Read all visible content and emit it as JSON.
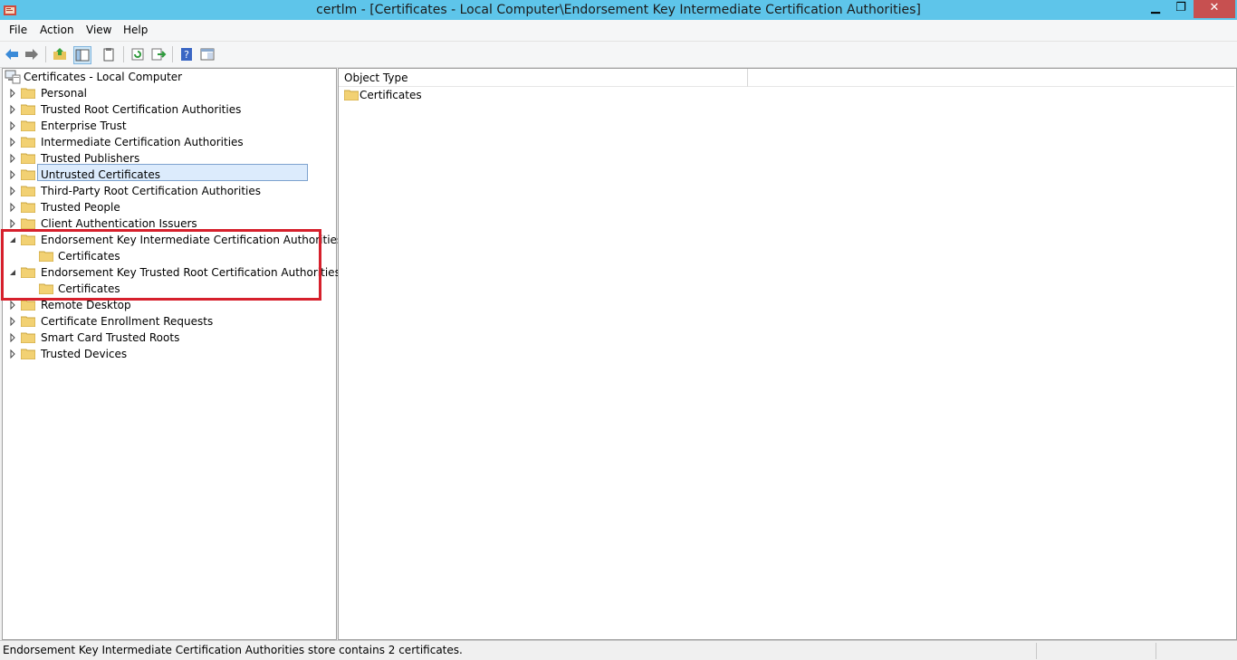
{
  "window": {
    "title": "certlm - [Certificates - Local Computer\\Endorsement Key Intermediate Certification Authorities]",
    "app_icon": "certificate-app-icon",
    "buttons": [
      "minimize",
      "restore",
      "close"
    ]
  },
  "menu": {
    "file": "File",
    "action": "Action",
    "view": "View",
    "help": "Help"
  },
  "toolbar": {
    "icons": [
      "back-arrow-icon",
      "forward-arrow-icon",
      "up-folder-icon",
      "show-hide-tree-icon",
      "clipboard-icon",
      "refresh-icon",
      "export-list-icon",
      "help-icon",
      "properties-icon"
    ]
  },
  "tree": {
    "root": "Certificates - Local Computer",
    "items": [
      {
        "label": "Personal",
        "expanded": false
      },
      {
        "label": "Trusted Root Certification Authorities",
        "expanded": false
      },
      {
        "label": "Enterprise Trust",
        "expanded": false
      },
      {
        "label": "Intermediate Certification Authorities",
        "expanded": false
      },
      {
        "label": "Trusted Publishers",
        "expanded": false
      },
      {
        "label": "Untrusted Certificates",
        "expanded": false
      },
      {
        "label": "Third-Party Root Certification Authorities",
        "expanded": false
      },
      {
        "label": "Trusted People",
        "expanded": false
      },
      {
        "label": "Client Authentication Issuers",
        "expanded": false
      },
      {
        "label": "Endorsement Key Intermediate Certification Authorities",
        "expanded": true,
        "selected": true,
        "child": "Certificates"
      },
      {
        "label": "Endorsement Key Trusted Root Certification Authorities",
        "expanded": true,
        "child": "Certificates"
      },
      {
        "label": "Remote Desktop",
        "expanded": false
      },
      {
        "label": "Certificate Enrollment Requests",
        "expanded": false
      },
      {
        "label": "Smart Card Trusted Roots",
        "expanded": false
      },
      {
        "label": "Trusted Devices",
        "expanded": false
      }
    ]
  },
  "list": {
    "column_header": "Object Type",
    "rows": [
      "Certificates"
    ]
  },
  "status": {
    "text": "Endorsement Key Intermediate Certification Authorities store contains 2 certificates."
  },
  "colors": {
    "titlebar": "#5ec5ea",
    "close_button": "#c75050",
    "selection": "#dcebfc",
    "highlight_box": "#d6202c",
    "folder": "#f2d173"
  }
}
